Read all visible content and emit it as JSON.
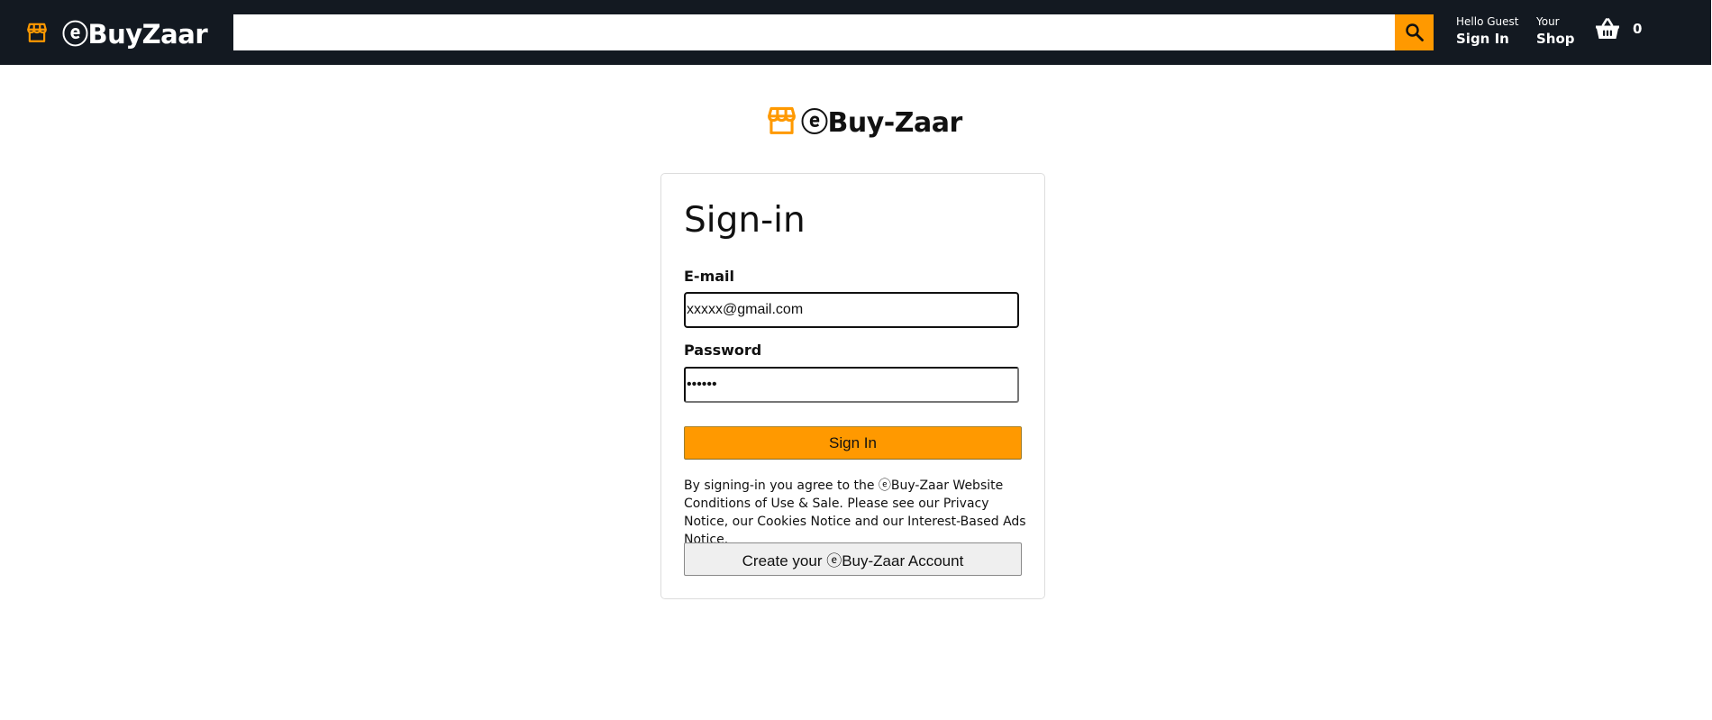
{
  "header": {
    "brand_text": "ⓔBuyZaar",
    "search": {
      "value": "",
      "placeholder": ""
    },
    "signin_option": {
      "line_one": "Hello Guest",
      "line_two": "Sign In"
    },
    "shop_option": {
      "line_one": "Your",
      "line_two": "Shop"
    },
    "basket": {
      "count": "0",
      "icon": "shopping-basket-icon"
    },
    "search_icon": "search-icon",
    "logo_icon": "storefront-icon"
  },
  "login": {
    "logo_text": "ⓔBuy-Zaar",
    "title": "Sign-in",
    "email_label": "E-mail",
    "email_value": "xxxxx@gmail.com",
    "password_label": "Password",
    "password_value": "••••••",
    "signin_button": "Sign In",
    "terms": "By signing-in you agree to the ⓔBuy-Zaar Website Conditions of Use & Sale. Please see our Privacy Notice, our Cookies Notice and our Interest-Based Ads Notice.",
    "register_button": "Create your ⓔBuy-Zaar Account"
  },
  "colors": {
    "header_bg": "#131921",
    "accent": "#ff9900",
    "text": "#111111"
  }
}
